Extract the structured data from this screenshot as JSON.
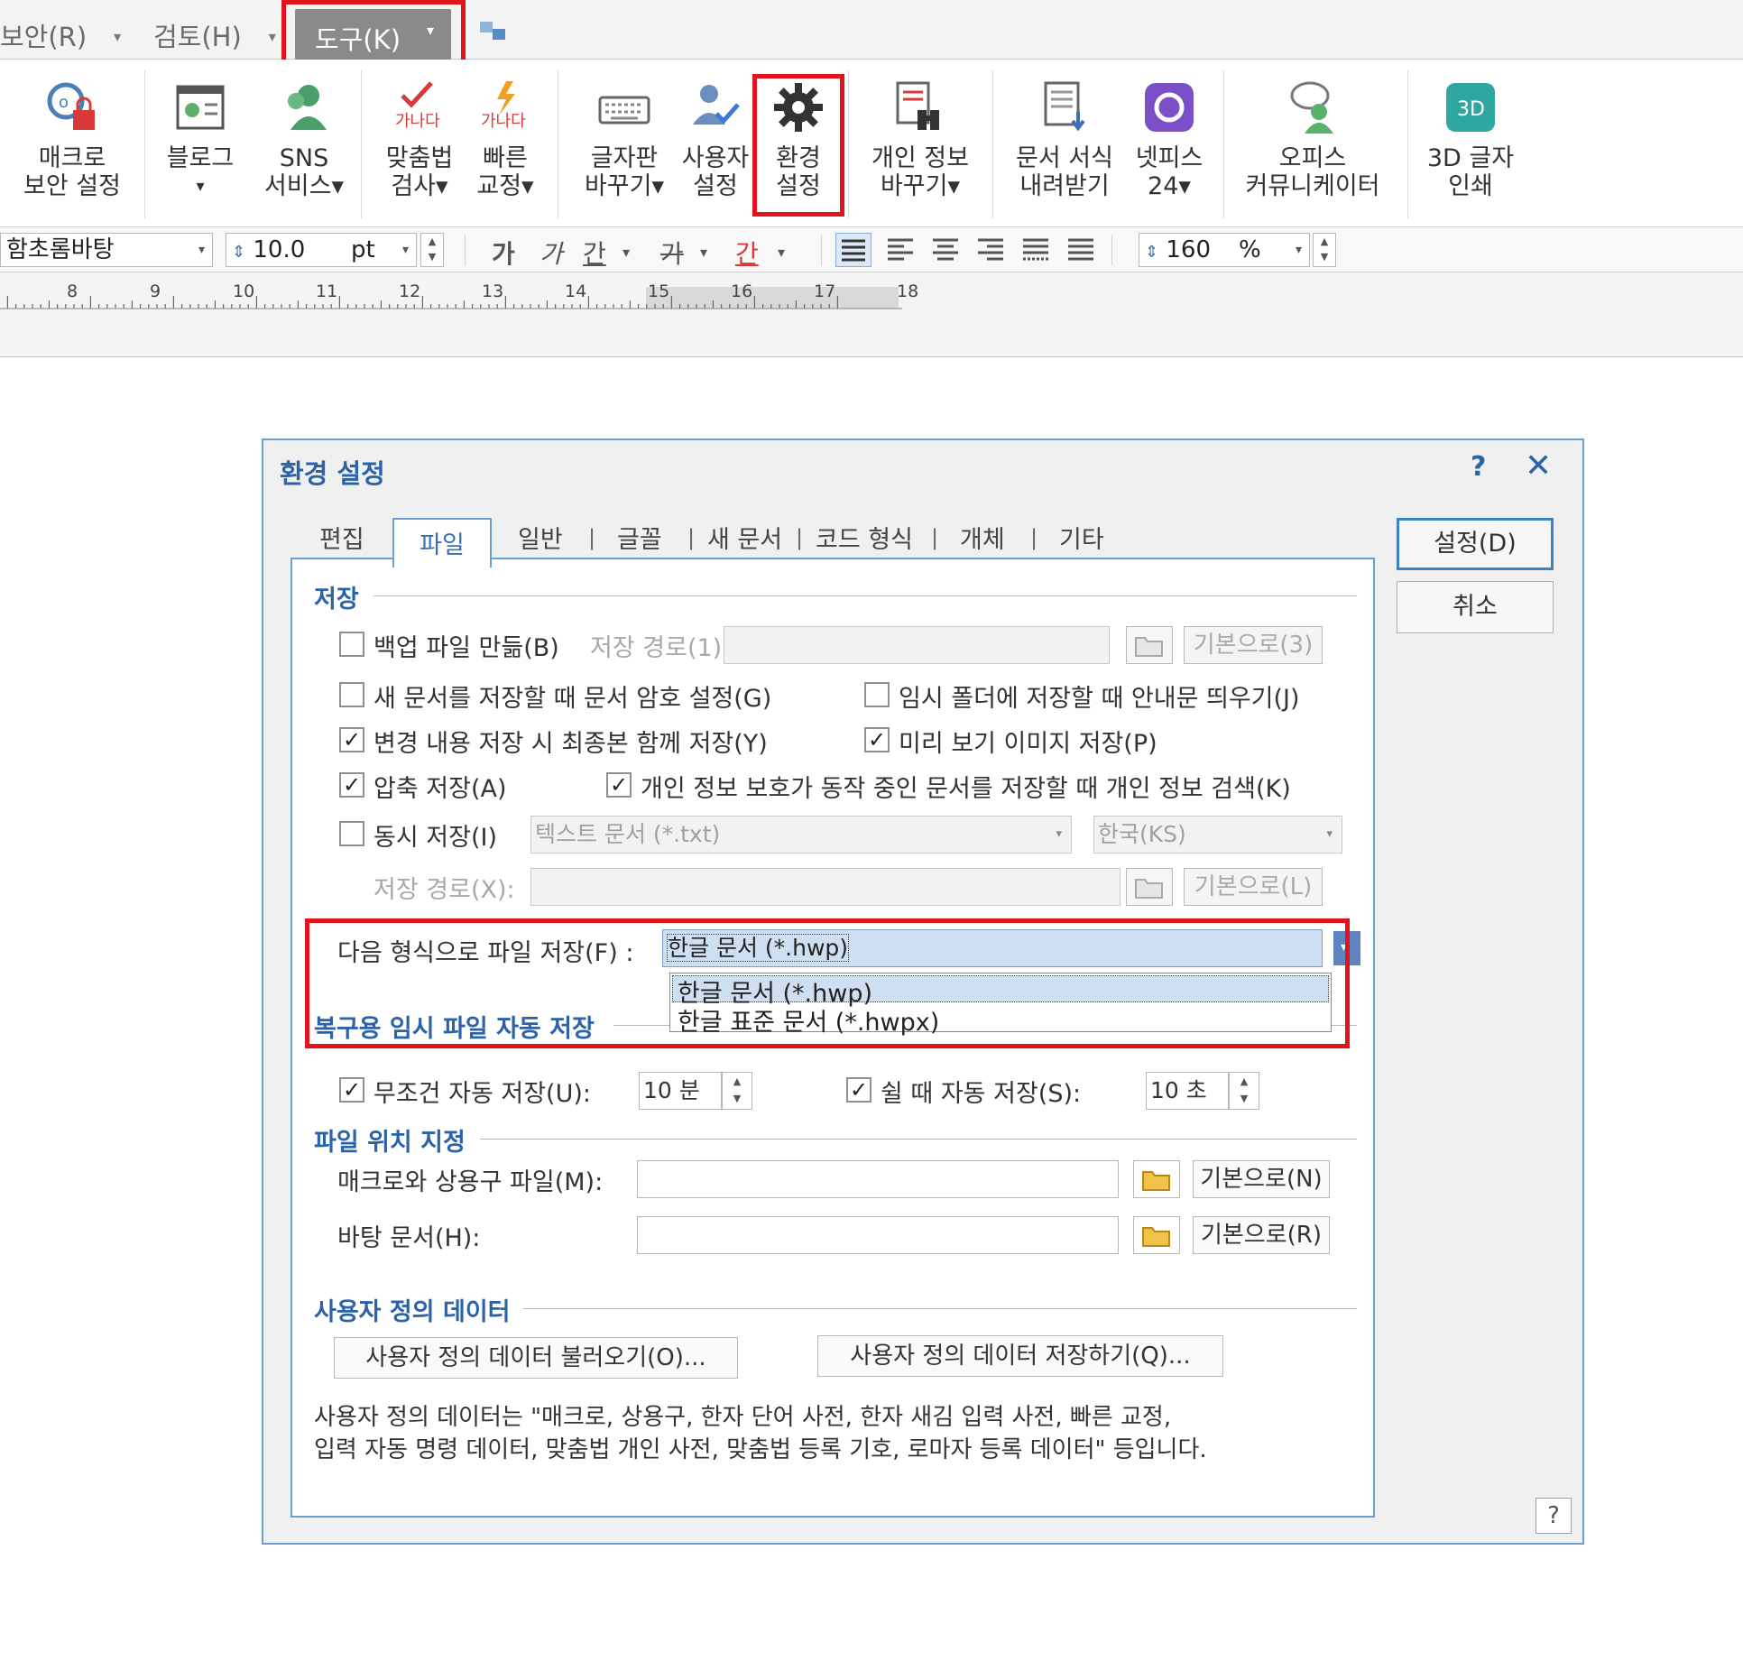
{
  "menu_tabs": {
    "security": "보안(R)",
    "review": "검토(H)",
    "tools": "도구(K)"
  },
  "ribbon": {
    "macro_security": [
      "매크로",
      "보안 설정"
    ],
    "blog": [
      "블로그",
      "▾"
    ],
    "sns": [
      "SNS",
      "서비스▾"
    ],
    "spell_check": [
      "맞춤법",
      "검사▾"
    ],
    "quick_correct": [
      "빠른",
      "교정▾"
    ],
    "keyboard_change": [
      "글자판",
      "바꾸기▾"
    ],
    "user_settings": [
      "사용자",
      "설정"
    ],
    "preferences": [
      "환경",
      "설정"
    ],
    "personal_info": [
      "개인 정보",
      "바꾸기▾"
    ],
    "doc_template_download": [
      "문서 서식",
      "내려받기"
    ],
    "netffice": [
      "넷피스",
      "24▾"
    ],
    "office_communicator": [
      "오피스",
      "커뮤니케이터"
    ],
    "print_3d": [
      "3D 글자",
      "인쇄"
    ],
    "spell_icon_text": "가나다"
  },
  "format_bar": {
    "font_name": "함초롬바탕",
    "font_size": "10.0",
    "font_unit": "pt",
    "bold": "가",
    "italic": "가",
    "underline": "간",
    "strike": "가",
    "color": "간",
    "line_spacing": "160",
    "line_spacing_unit": "%"
  },
  "ruler": {
    "numbers": [
      "8",
      "9",
      "10",
      "11",
      "12",
      "13",
      "14",
      "15",
      "16",
      "17",
      "18"
    ]
  },
  "dialog": {
    "title": "환경 설정",
    "help": "?",
    "close": "✕",
    "tabs": [
      "편집",
      "파일",
      "일반",
      "글꼴",
      "새 문서",
      "코드 형식",
      "개체",
      "기타"
    ],
    "tab_separator": "|",
    "active_tab": "파일",
    "ok_button": "설정(D)",
    "cancel_button": "취소",
    "sections": {
      "save": "저장",
      "autosave": "복구용 임시 파일 자동 저장",
      "file_location": "파일 위치 지정",
      "user_data": "사용자 정의 데이터"
    },
    "save": {
      "backup": "백업 파일 만듦(B)",
      "backup_checked": false,
      "save_path_label": "저장 경로(1):",
      "default_btn_3": "기본으로(3)",
      "password": "새 문서를 저장할 때 문서 암호 설정(G)",
      "password_checked": false,
      "temp_folder_notice": "임시 폴더에 저장할 때 안내문 띄우기(J)",
      "temp_folder_notice_checked": false,
      "save_final": "변경 내용 저장 시 최종본 함께 저장(Y)",
      "save_final_checked": true,
      "preview_image": "미리 보기 이미지 저장(P)",
      "preview_image_checked": true,
      "compress": "압축 저장(A)",
      "compress_checked": true,
      "privacy_search": "개인 정보 보호가 동작 중인 문서를 저장할 때 개인 정보 검색(K)",
      "privacy_search_checked": true,
      "simultaneous": "동시 저장(I)",
      "simultaneous_checked": false,
      "sim_format": "텍스트 문서 (*.txt)",
      "sim_encoding": "한국(KS)",
      "sim_path_label": "저장 경로(X):",
      "default_btn_L": "기본으로(L)",
      "save_format_label": "다음 형식으로 파일 저장(F) :",
      "save_format_value": "한글 문서 (*.hwp)",
      "save_format_options": [
        "한글 문서 (*.hwp)",
        "한글 표준 문서 (*.hwpx)"
      ]
    },
    "autosave": {
      "always": "무조건 자동 저장(U):",
      "always_checked": true,
      "always_value": "10 분",
      "idle": "쉴 때 자동 저장(S):",
      "idle_checked": true,
      "idle_value": "10 초"
    },
    "file_location": {
      "macro_label": "매크로와 상용구 파일(M):",
      "macro_default": "기본으로(N)",
      "template_label": "바탕 문서(H):",
      "template_default": "기본으로(R)"
    },
    "user_data": {
      "load_button": "사용자 정의 데이터 불러오기(O)...",
      "save_button": "사용자 정의 데이터 저장하기(Q)...",
      "description_line1": "사용자 정의 데이터는 \"매크로, 상용구, 한자 단어 사전, 한자 새김 입력 사전, 빠른 교정,",
      "description_line2": "입력 자동 명령 데이터, 맞춤법 개인 사전, 맞춤법 등록 기호, 로마자 등록 데이터\" 등입니다."
    },
    "bottom_help": "?"
  },
  "colors": {
    "highlight": "#e3131d",
    "accent": "#2c63a8",
    "dialog_border": "#6a9fd0"
  }
}
